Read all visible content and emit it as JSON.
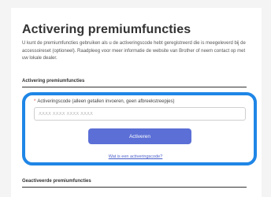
{
  "page": {
    "title": "Activering premiumfuncties",
    "intro": "U kunt de premiumfuncties gebruiken als u de activeringscode hebt geregistreerd die is meegeleverd bij de accessoireset (optioneel). Raadpleeg voor meer informatie de website van Brother of neem contact op met uw lokale dealer."
  },
  "activation": {
    "heading": "Activering premiumfuncties",
    "required_marker": "*",
    "field_label": "Activeringscode (alleen getallen invoeren, geen afbreekstreepjes)",
    "input_placeholder": "XXXX XXXX XXXX XXXX",
    "input_value": "",
    "button_label": "Activeren",
    "help_link": "Wat is een activeringscode?"
  },
  "activated": {
    "heading": "Geactiveerde premiumfuncties"
  },
  "colors": {
    "highlight_border": "#1f86e6",
    "button": "#5b6fd6",
    "link": "#4a5fc9"
  }
}
